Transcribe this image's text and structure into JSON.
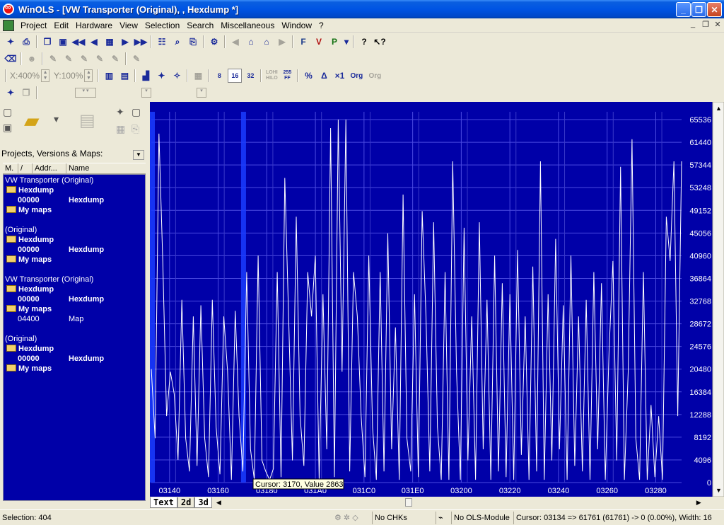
{
  "window": {
    "title": "WinOLS - [VW Transporter (Original), , Hexdump *]"
  },
  "menu": [
    "Project",
    "Edit",
    "Hardware",
    "View",
    "Selection",
    "Search",
    "Miscellaneous",
    "Window",
    "?"
  ],
  "toolbar2": {
    "zoom_x": "X:400%",
    "zoom_y": "Y:100%",
    "bits8": "8",
    "bits16": "16",
    "bits32": "32",
    "lohi": "LOHI",
    "hilo": "HILO",
    "val255": "255",
    "valFF": "FF",
    "percent": "%",
    "delta": "Δ",
    "x1": "×1",
    "org": "Org",
    "org2": "Org"
  },
  "projects_label": "Projects, Versions & Maps:",
  "list_columns": [
    "M.",
    "/",
    "Addr...",
    "Name"
  ],
  "tree": [
    {
      "text": "VW Transporter (Original)",
      "bold": false,
      "indent": 0,
      "folder": false
    },
    {
      "text": "Hexdump",
      "bold": true,
      "indent": 1,
      "folder": true
    },
    {
      "text": "00000",
      "name": "Hexdump",
      "bold": true,
      "indent": 2,
      "folder": false
    },
    {
      "text": "My maps",
      "bold": true,
      "indent": 1,
      "folder": true
    },
    {
      "text": "",
      "bold": false,
      "indent": 0,
      "folder": false
    },
    {
      "text": "(Original)",
      "bold": false,
      "indent": 0,
      "folder": false
    },
    {
      "text": "Hexdump",
      "bold": true,
      "indent": 1,
      "folder": true
    },
    {
      "text": "00000",
      "name": "Hexdump",
      "bold": true,
      "indent": 2,
      "folder": false
    },
    {
      "text": "My maps",
      "bold": true,
      "indent": 1,
      "folder": true
    },
    {
      "text": "",
      "bold": false,
      "indent": 0,
      "folder": false
    },
    {
      "text": "VW Transporter (Original)",
      "bold": false,
      "indent": 0,
      "folder": false
    },
    {
      "text": "Hexdump",
      "bold": true,
      "indent": 1,
      "folder": true
    },
    {
      "text": "00000",
      "name": "Hexdump",
      "bold": true,
      "indent": 2,
      "folder": false
    },
    {
      "text": "My maps",
      "bold": true,
      "indent": 1,
      "folder": true
    },
    {
      "text": "04400",
      "name": "Map",
      "bold": false,
      "indent": 2,
      "folder": false
    },
    {
      "text": "",
      "bold": false,
      "indent": 0,
      "folder": false
    },
    {
      "text": "(Original)",
      "bold": false,
      "indent": 0,
      "folder": false
    },
    {
      "text": "Hexdump",
      "bold": true,
      "indent": 1,
      "folder": true
    },
    {
      "text": "00000",
      "name": "Hexdump",
      "bold": true,
      "indent": 2,
      "folder": false
    },
    {
      "text": "My maps",
      "bold": true,
      "indent": 1,
      "folder": true
    }
  ],
  "tabs": [
    "Text",
    "2d",
    "3d"
  ],
  "status": {
    "selection": "Selection: 404",
    "chks": "No CHKs",
    "module": "No OLS-Module",
    "cursor": "Cursor: 03134 => 61761 (61761) -> 0 (0.00%), Width: 16"
  },
  "tooltip": "Cursor: 3170, Value 2863",
  "chart_data": {
    "type": "line",
    "y_ticks": [
      0,
      4096,
      8192,
      12288,
      16384,
      20480,
      24576,
      28672,
      32768,
      36864,
      40960,
      45056,
      49152,
      53248,
      57344,
      61440,
      65536
    ],
    "x_ticks": [
      "03140",
      "03160",
      "03180",
      "031A0",
      "031C0",
      "031E0",
      "03200",
      "03220",
      "03240",
      "03260",
      "03280"
    ],
    "ylim": [
      0,
      65536
    ],
    "grid": true,
    "highlight_columns": [
      3134,
      3170
    ],
    "values": [
      20480,
      8000,
      63000,
      40000,
      12000,
      20000,
      16000,
      4096,
      33000,
      8000,
      2000,
      30000,
      3000,
      32000,
      8000,
      1000,
      33000,
      10000,
      1500,
      30000,
      20000,
      500,
      31000,
      12000,
      2000,
      38000,
      6000,
      500,
      41000,
      4000,
      2000,
      500,
      2500,
      38000,
      1000,
      55000,
      30000,
      4000,
      48000,
      12000,
      3000,
      38000,
      30000,
      41000,
      500,
      34000,
      6000,
      64000,
      1000,
      66000,
      20000,
      66000,
      2000,
      38000,
      30000,
      12000,
      1000,
      41000,
      10000,
      500,
      38000,
      2000,
      45000,
      6000,
      28000,
      500,
      52000,
      8000,
      2000,
      34000,
      1000,
      49000,
      30000,
      2000,
      47000,
      10000,
      500,
      38000,
      500,
      58000,
      20000,
      500,
      46000,
      4000,
      30000,
      500,
      47000,
      6000,
      33000,
      500,
      41000,
      2000,
      36000,
      1000,
      34000,
      500,
      42000,
      5000,
      30000,
      500,
      39000,
      2000,
      58000,
      500,
      34000,
      4000,
      44000,
      6000,
      32000,
      500,
      41000,
      3000,
      30000,
      2000,
      33000,
      500,
      38000,
      6000,
      36000,
      500,
      24000,
      40000,
      4000,
      57000,
      500,
      20000,
      62000,
      8000,
      500,
      38000,
      500,
      14000,
      1000,
      12000,
      500,
      48000,
      40000,
      58000,
      12000,
      58000
    ]
  }
}
